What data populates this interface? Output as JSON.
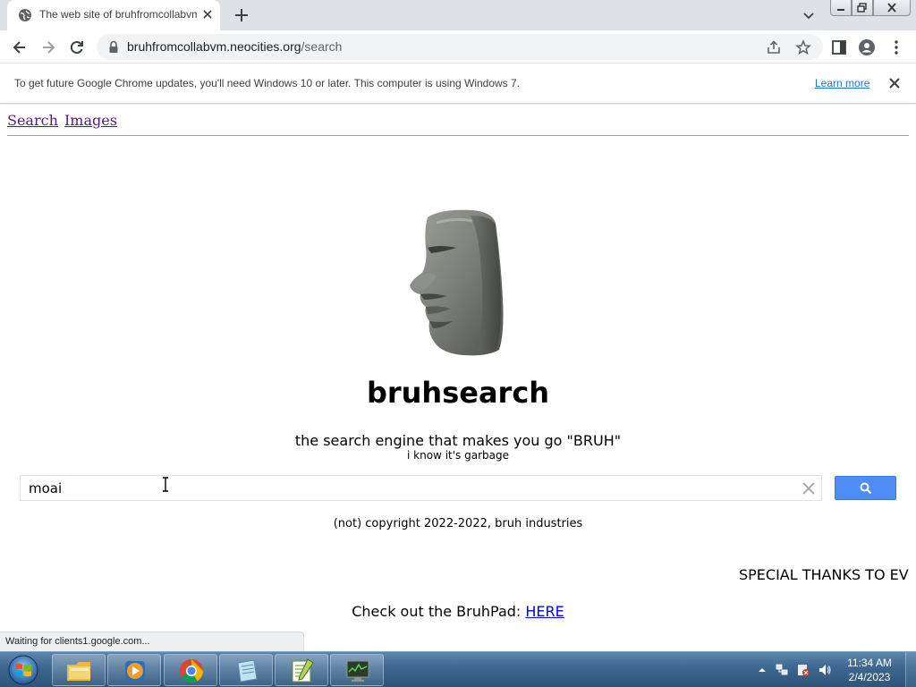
{
  "browser": {
    "tab_title": "The web site of bruhfromcollabvm",
    "url_host": "bruhfromcollabvm.neocities.org",
    "url_path": "/search"
  },
  "infobar": {
    "message": "To get future Google Chrome updates, you'll need Windows 10 or later. This computer is using Windows 7.",
    "link_label": "Learn more"
  },
  "page": {
    "nav": [
      "Search",
      "Images"
    ],
    "brand": "bruhsearch",
    "tagline": "the search engine that makes you go \"BRUH\"",
    "subtagline": "i know it's garbage",
    "search_value": "moai",
    "copyright": "(not) copyright 2022-2022, bruh industries",
    "marquee": "SPECIAL THANKS TO EVERYONE",
    "bruhpad_text": "Check out the BruhPad: ",
    "bruhpad_link": "HERE"
  },
  "status_text": "Waiting for clients1.google.com...",
  "taskbar": {
    "clock_time": "11:34 AM",
    "clock_date": "2/4/2023"
  },
  "colors": {
    "link_visited": "#551a8b",
    "link": "#0000ee",
    "search_button": "#4f8df5",
    "chrome_blue": "#1a73e8"
  },
  "icons": [
    "globe-icon",
    "close-icon",
    "plus-icon",
    "chevron-down-icon",
    "back-icon",
    "forward-icon",
    "reload-icon",
    "lock-icon",
    "share-icon",
    "star-icon",
    "side-panel-icon",
    "profile-icon",
    "kebab-menu-icon",
    "magnifier-icon",
    "windows-start-icon",
    "folder-icon",
    "media-player-icon",
    "chrome-icon",
    "notepad-icon",
    "task-manager-icon"
  ]
}
